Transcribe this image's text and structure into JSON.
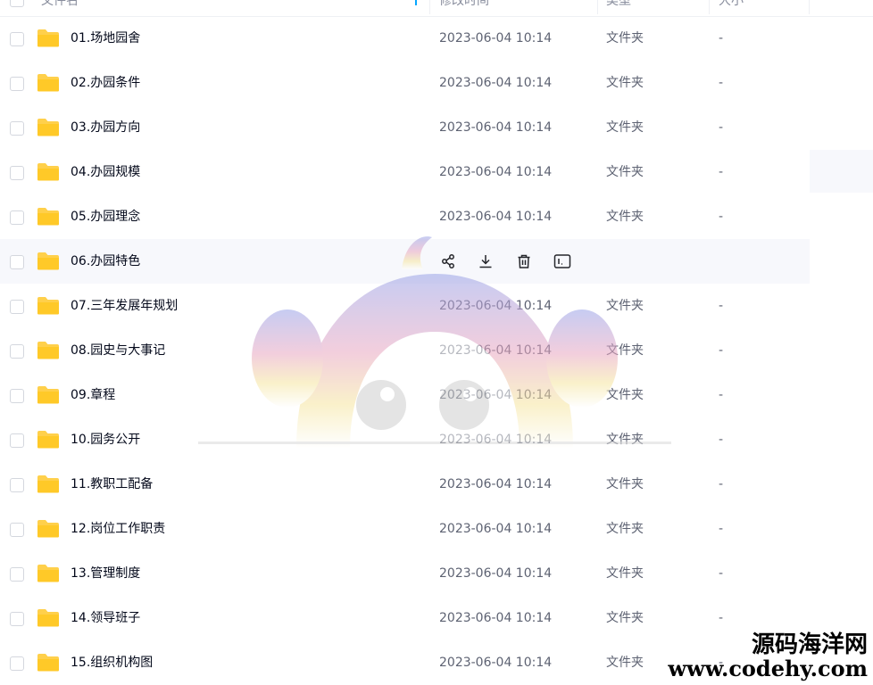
{
  "header": {
    "name_col": "文件名",
    "date_col": "修改时间",
    "type_col": "类型",
    "size_col": "大小"
  },
  "rows": [
    {
      "name": "01.场地园舍",
      "date": "2023-06-04 10:14",
      "type": "文件夹",
      "size": "-"
    },
    {
      "name": "02.办园条件",
      "date": "2023-06-04 10:14",
      "type": "文件夹",
      "size": "-"
    },
    {
      "name": "03.办园方向",
      "date": "2023-06-04 10:14",
      "type": "文件夹",
      "size": "-"
    },
    {
      "name": "04.办园规模",
      "date": "2023-06-04 10:14",
      "type": "文件夹",
      "size": "-"
    },
    {
      "name": "05.办园理念",
      "date": "2023-06-04 10:14",
      "type": "文件夹",
      "size": "-"
    },
    {
      "name": "06.办园特色",
      "date": "",
      "type": "",
      "size": ""
    },
    {
      "name": "07.三年发展年规划",
      "date": "2023-06-04 10:14",
      "type": "文件夹",
      "size": "-"
    },
    {
      "name": "08.园史与大事记",
      "date": "2023-06-04 10:14",
      "type": "文件夹",
      "size": "-"
    },
    {
      "name": "09.章程",
      "date": "2023-06-04 10:14",
      "type": "文件夹",
      "size": "-"
    },
    {
      "name": "10.园务公开",
      "date": "2023-06-04 10:14",
      "type": "文件夹",
      "size": "-"
    },
    {
      "name": "11.教职工配备",
      "date": "2023-06-04 10:14",
      "type": "文件夹",
      "size": "-"
    },
    {
      "name": "12.岗位工作职责",
      "date": "2023-06-04 10:14",
      "type": "文件夹",
      "size": "-"
    },
    {
      "name": "13.管理制度",
      "date": "2023-06-04 10:14",
      "type": "文件夹",
      "size": "-"
    },
    {
      "name": "14.领导班子",
      "date": "2023-06-04 10:14",
      "type": "文件夹",
      "size": "-"
    },
    {
      "name": "15.组织机构图",
      "date": "2023-06-04 10:14",
      "type": "文件夹",
      "size": "-"
    }
  ],
  "hover_actions": [
    "share-icon",
    "download-icon",
    "delete-icon",
    "more-icon"
  ],
  "brand": {
    "cn": "源码海洋网",
    "url": "www.codehy.com"
  },
  "colors": {
    "folder": "#ffd04b",
    "accent": "#06a7ff",
    "hover_row": "#f7f8fc"
  }
}
